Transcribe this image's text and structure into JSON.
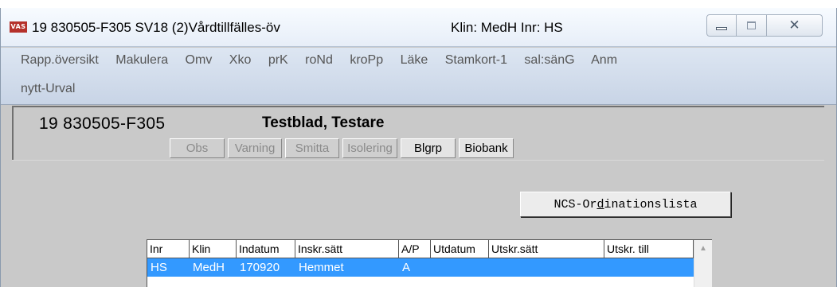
{
  "window": {
    "app_icon": "VAS",
    "title": "19 830505-F305   SV18 (2)Vårdtillfälles-öv",
    "title_right": "Klin: MedH  Inr: HS",
    "controls": {
      "minimize": "minimize-icon",
      "maximize": "maximize-icon",
      "close": "close-icon"
    }
  },
  "menu": {
    "row1": [
      "Rapp.översikt",
      "Makulera",
      "Omv",
      "Xko",
      "prK",
      "roNd",
      "kroPp",
      "Läke",
      "Stamkort-1",
      "sal:sänG",
      "Anm"
    ],
    "row2": "nytt-Urval"
  },
  "patient": {
    "personnummer": "19 830505-F305",
    "name": "Testblad, Testare",
    "flags": [
      {
        "label": "Obs",
        "active": false
      },
      {
        "label": "Varning",
        "active": false
      },
      {
        "label": "Smitta",
        "active": false
      },
      {
        "label": "Isolering",
        "active": false
      },
      {
        "label": "Blgrp",
        "active": true
      },
      {
        "label": "Biobank",
        "active": true
      }
    ]
  },
  "ncs_button": {
    "before": "NCS-Or",
    "underlined": "d",
    "after": "inationslista"
  },
  "table": {
    "columns": [
      "Inr",
      "Klin",
      "Indatum",
      "Inskr.sätt",
      "A/P",
      "Utdatum",
      "Utskr.sätt",
      "Utskr. till"
    ],
    "rows": [
      [
        "HS",
        "MedH",
        "170920",
        "Hemmet",
        "A",
        "",
        "",
        ""
      ]
    ]
  },
  "colors": {
    "selection": "#3399ff",
    "app_icon": "#b5312b",
    "background": "#c9c9c9"
  }
}
